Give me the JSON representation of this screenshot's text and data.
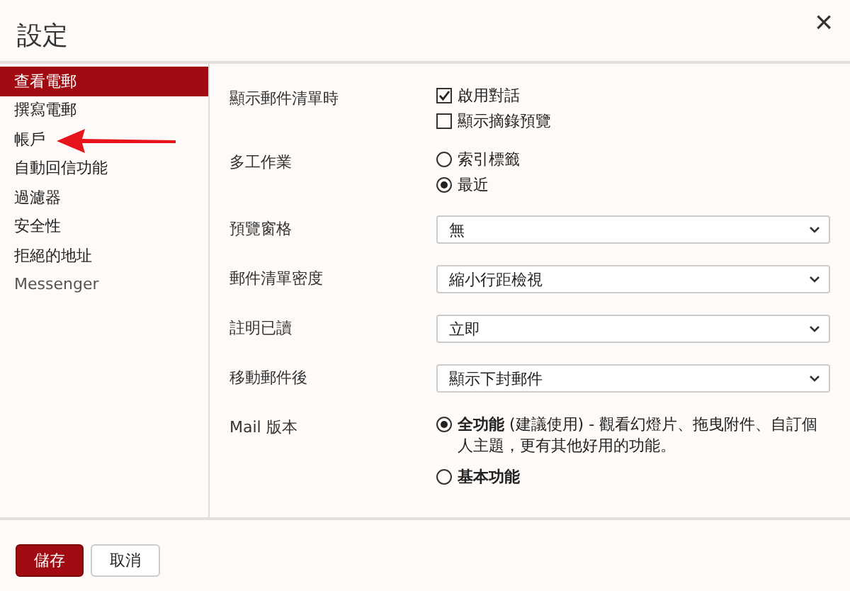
{
  "dialog": {
    "title": "設定",
    "close": "×"
  },
  "sidebar": {
    "items": [
      {
        "label": "查看電郵",
        "selected": true
      },
      {
        "label": "撰寫電郵",
        "selected": false
      },
      {
        "label": "帳戶",
        "selected": false
      },
      {
        "label": "自動回信功能",
        "selected": false
      },
      {
        "label": "過濾器",
        "selected": false
      },
      {
        "label": "安全性",
        "selected": false
      },
      {
        "label": "拒絕的地址",
        "selected": false
      },
      {
        "label": "Messenger",
        "selected": false
      }
    ]
  },
  "settings": [
    {
      "kind": "checkboxes",
      "label": "顯示郵件清單時",
      "options": [
        {
          "text": "啟用對話",
          "checked": true
        },
        {
          "text": "顯示摘錄預覽",
          "checked": false
        }
      ]
    },
    {
      "kind": "radios",
      "label": "多工作業",
      "options": [
        {
          "text": "索引標籤",
          "selected": false
        },
        {
          "text": "最近",
          "selected": true
        }
      ]
    },
    {
      "kind": "select",
      "label": "預覽窗格",
      "value": "無"
    },
    {
      "kind": "select",
      "label": "郵件清單密度",
      "value": "縮小行距檢視"
    },
    {
      "kind": "select",
      "label": "註明已讀",
      "value": "立即"
    },
    {
      "kind": "select",
      "label": "移動郵件後",
      "value": "顯示下封郵件"
    },
    {
      "kind": "radios",
      "label": "Mail 版本",
      "options": [
        {
          "text": "**全功能** (建議使用) - 觀看幻燈片、拖曳附件、自訂個人主題，更有其他好用的功能。",
          "selected": true
        },
        {
          "text": "基本功能",
          "selected": false
        }
      ]
    }
  ],
  "annotation": {
    "kind": "arrow",
    "color": "#e8141c"
  },
  "buttons": [
    {
      "label": "儲存",
      "kind": "primary"
    },
    {
      "label": "取消",
      "kind": "secondary"
    }
  ]
}
